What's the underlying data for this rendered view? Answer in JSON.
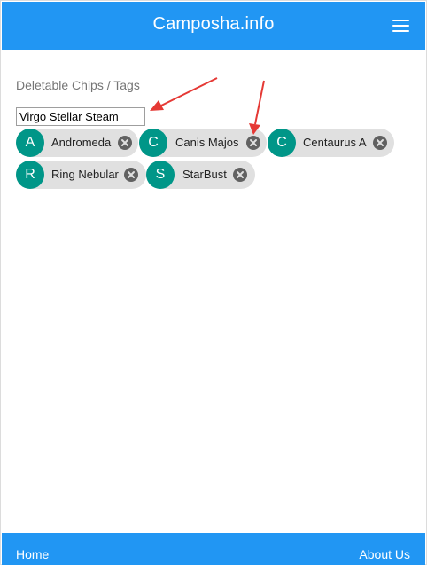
{
  "header": {
    "brand": "Camposha.info",
    "menu_icon": "hamburger-menu-icon"
  },
  "section": {
    "title": "Deletable Chips / Tags"
  },
  "input": {
    "value": "Virgo Stellar Steam"
  },
  "chips": [
    {
      "initial": "A",
      "label": "Andromeda"
    },
    {
      "initial": "C",
      "label": "Canis Majos"
    },
    {
      "initial": "C",
      "label": "Centaurus A"
    },
    {
      "initial": "R",
      "label": "Ring Nebular"
    },
    {
      "initial": "S",
      "label": "StarBust"
    }
  ],
  "footer": {
    "home": "Home",
    "about": "About Us"
  },
  "colors": {
    "primary": "#2196f3",
    "avatar": "#009688",
    "chip_bg": "#e0e0e0",
    "arrow": "#e53935"
  }
}
